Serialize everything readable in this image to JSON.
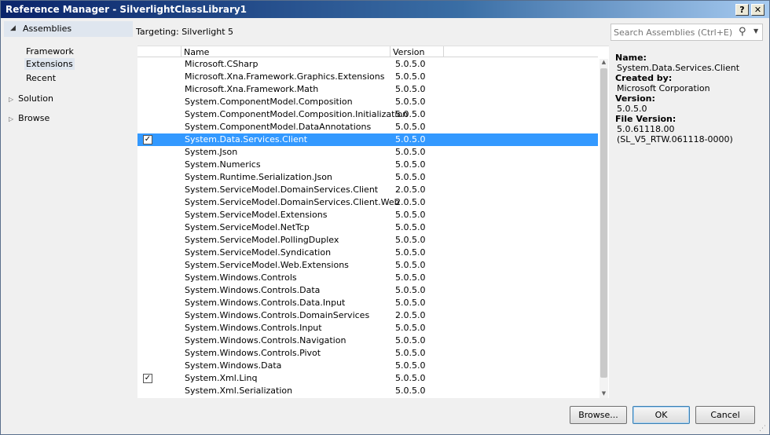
{
  "window": {
    "title": "Reference Manager - SilverlightClassLibrary1",
    "help_label": "?",
    "close_label": "✕"
  },
  "nav": {
    "assemblies_label": "Assemblies",
    "sub_items": [
      {
        "label": "Framework",
        "selected": false
      },
      {
        "label": "Extensions",
        "selected": true
      },
      {
        "label": "Recent",
        "selected": false
      }
    ],
    "solution_label": "Solution",
    "browse_label": "Browse"
  },
  "targeting": "Targeting: Silverlight 5",
  "grid": {
    "col_name": "Name",
    "col_version": "Version",
    "rows": [
      {
        "name": "Microsoft.CSharp",
        "version": "5.0.5.0",
        "checked": false,
        "selected": false
      },
      {
        "name": "Microsoft.Xna.Framework.Graphics.Extensions",
        "version": "5.0.5.0",
        "checked": false,
        "selected": false
      },
      {
        "name": "Microsoft.Xna.Framework.Math",
        "version": "5.0.5.0",
        "checked": false,
        "selected": false
      },
      {
        "name": "System.ComponentModel.Composition",
        "version": "5.0.5.0",
        "checked": false,
        "selected": false
      },
      {
        "name": "System.ComponentModel.Composition.Initialization",
        "version": "5.0.5.0",
        "checked": false,
        "selected": false
      },
      {
        "name": "System.ComponentModel.DataAnnotations",
        "version": "5.0.5.0",
        "checked": false,
        "selected": false
      },
      {
        "name": "System.Data.Services.Client",
        "version": "5.0.5.0",
        "checked": true,
        "selected": true
      },
      {
        "name": "System.Json",
        "version": "5.0.5.0",
        "checked": false,
        "selected": false
      },
      {
        "name": "System.Numerics",
        "version": "5.0.5.0",
        "checked": false,
        "selected": false
      },
      {
        "name": "System.Runtime.Serialization.Json",
        "version": "5.0.5.0",
        "checked": false,
        "selected": false
      },
      {
        "name": "System.ServiceModel.DomainServices.Client",
        "version": "2.0.5.0",
        "checked": false,
        "selected": false
      },
      {
        "name": "System.ServiceModel.DomainServices.Client.Web",
        "version": "2.0.5.0",
        "checked": false,
        "selected": false
      },
      {
        "name": "System.ServiceModel.Extensions",
        "version": "5.0.5.0",
        "checked": false,
        "selected": false
      },
      {
        "name": "System.ServiceModel.NetTcp",
        "version": "5.0.5.0",
        "checked": false,
        "selected": false
      },
      {
        "name": "System.ServiceModel.PollingDuplex",
        "version": "5.0.5.0",
        "checked": false,
        "selected": false
      },
      {
        "name": "System.ServiceModel.Syndication",
        "version": "5.0.5.0",
        "checked": false,
        "selected": false
      },
      {
        "name": "System.ServiceModel.Web.Extensions",
        "version": "5.0.5.0",
        "checked": false,
        "selected": false
      },
      {
        "name": "System.Windows.Controls",
        "version": "5.0.5.0",
        "checked": false,
        "selected": false
      },
      {
        "name": "System.Windows.Controls.Data",
        "version": "5.0.5.0",
        "checked": false,
        "selected": false
      },
      {
        "name": "System.Windows.Controls.Data.Input",
        "version": "5.0.5.0",
        "checked": false,
        "selected": false
      },
      {
        "name": "System.Windows.Controls.DomainServices",
        "version": "2.0.5.0",
        "checked": false,
        "selected": false
      },
      {
        "name": "System.Windows.Controls.Input",
        "version": "5.0.5.0",
        "checked": false,
        "selected": false
      },
      {
        "name": "System.Windows.Controls.Navigation",
        "version": "5.0.5.0",
        "checked": false,
        "selected": false
      },
      {
        "name": "System.Windows.Controls.Pivot",
        "version": "5.0.5.0",
        "checked": false,
        "selected": false
      },
      {
        "name": "System.Windows.Data",
        "version": "5.0.5.0",
        "checked": false,
        "selected": false
      },
      {
        "name": "System.Xml.Linq",
        "version": "5.0.5.0",
        "checked": true,
        "selected": false
      },
      {
        "name": "System.Xml.Serialization",
        "version": "5.0.5.0",
        "checked": false,
        "selected": false
      }
    ]
  },
  "search": {
    "placeholder": "Search Assemblies (Ctrl+E)"
  },
  "details": {
    "name_label": "Name:",
    "name_value": "System.Data.Services.Client",
    "created_label": "Created by:",
    "created_value": "Microsoft Corporation",
    "version_label": "Version:",
    "version_value": "5.0.5.0",
    "file_version_label": "File Version:",
    "file_version_value": "5.0.61118.00",
    "file_version_build": "(SL_V5_RTW.061118-0000)"
  },
  "buttons": {
    "browse": "Browse...",
    "ok": "OK",
    "cancel": "Cancel"
  },
  "colors": {
    "selection": "#3399ff",
    "nav_highlight": "#dfe6ef"
  }
}
